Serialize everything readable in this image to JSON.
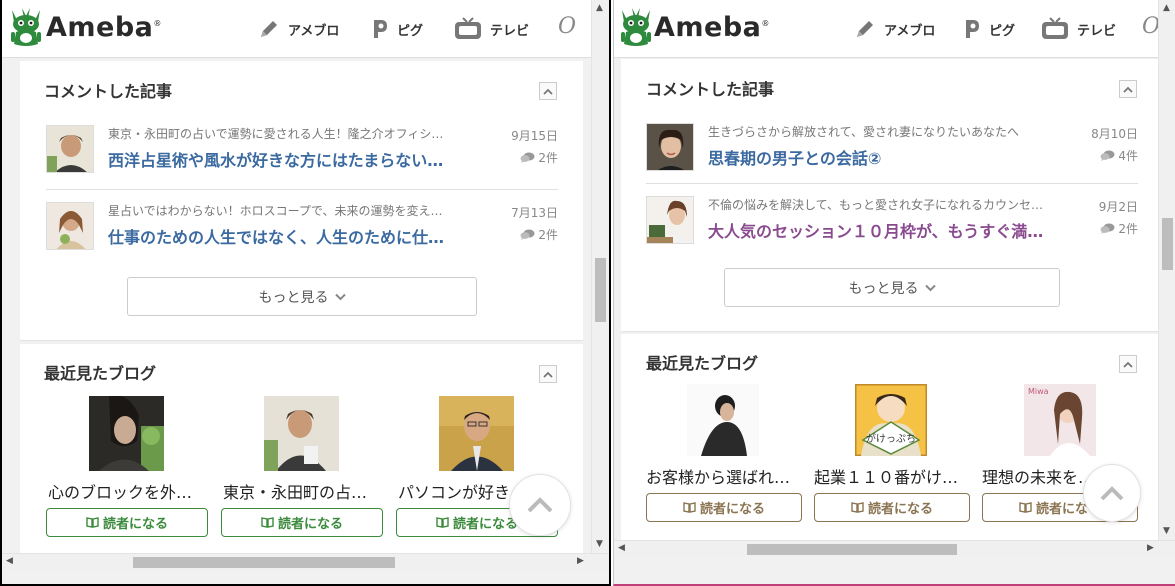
{
  "left": {
    "header": {
      "logo_text": "Ameba",
      "nav": [
        {
          "label": "アメブロ",
          "icon": "pencil-icon"
        },
        {
          "label": "ピグ",
          "icon": "pigg-icon"
        },
        {
          "label": "テレビ",
          "icon": "tv-icon"
        }
      ]
    },
    "comments": {
      "title": "コメントした記事",
      "items": [
        {
          "sub": "東京・永田町の占いで運勢に愛される人生！隆之介オフィシ…",
          "title": "西洋占星術や風水が好きな方にはたまらない…",
          "date": "9月15日",
          "count": "2件"
        },
        {
          "sub": "星占いではわからない！ホロスコープで、未来の運勢を変え…",
          "title": "仕事のための人生ではなく、人生のために仕…",
          "date": "7月13日",
          "count": "2件"
        }
      ],
      "more_label": "もっと見る"
    },
    "recent": {
      "title": "最近見たブログ",
      "blogs": [
        {
          "name": "心のブロックを外…",
          "follow_label": "読者になる"
        },
        {
          "name": "東京・永田町の占…",
          "follow_label": "読者になる"
        },
        {
          "name": "パソコンが好き…",
          "follow_label": "読者になる"
        }
      ]
    }
  },
  "right": {
    "header": {
      "logo_text": "Ameba",
      "nav": [
        {
          "label": "アメブロ",
          "icon": "pencil-icon"
        },
        {
          "label": "ピグ",
          "icon": "pigg-icon"
        },
        {
          "label": "テレビ",
          "icon": "tv-icon"
        }
      ]
    },
    "comments": {
      "title": "コメントした記事",
      "items": [
        {
          "sub": "生きづらさから解放されて、愛され妻になりたいあなたへ",
          "title": "思春期の男子との会話②",
          "date": "8月10日",
          "count": "4件"
        },
        {
          "sub": "不倫の悩みを解決して、もっと愛され女子になれるカウンセ…",
          "title": "大人気のセッション１０月枠が、もうすぐ満…",
          "date": "9月2日",
          "count": "2件"
        }
      ],
      "more_label": "もっと見る"
    },
    "recent": {
      "title": "最近見たブログ",
      "blogs": [
        {
          "name": "お客様から選ばれ…",
          "follow_label": "読者になる"
        },
        {
          "name": "起業１１０番がけ…",
          "follow_label": "読者になる",
          "img_text": "がけっぷち"
        },
        {
          "name": "理想の未来を…",
          "follow_label": "読者になる",
          "img_text": "Miwa"
        }
      ]
    }
  },
  "colors": {
    "link_blue": "#3b6aa0",
    "link_purple": "#8a4a8f",
    "follow_green": "#3c8a3c",
    "follow_brown": "#8a7452",
    "logo_green": "#2e8b3e"
  }
}
